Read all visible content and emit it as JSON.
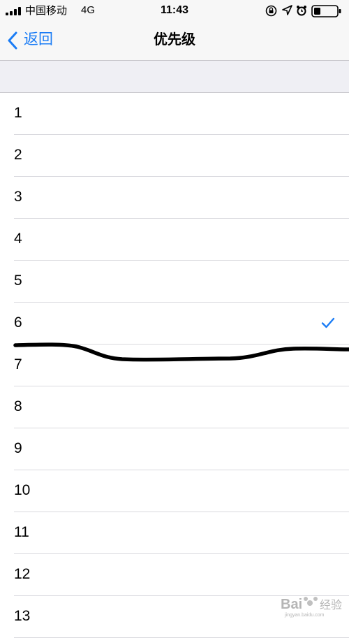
{
  "status_bar": {
    "carrier": "中国移动",
    "network": "4G",
    "time": "11:43"
  },
  "nav": {
    "back_label": "返回",
    "title": "优先级"
  },
  "accent_color": "#1a7cf5",
  "priority_list": {
    "selected": "6",
    "items": [
      {
        "label": "1"
      },
      {
        "label": "2"
      },
      {
        "label": "3"
      },
      {
        "label": "4"
      },
      {
        "label": "5"
      },
      {
        "label": "6"
      },
      {
        "label": "7"
      },
      {
        "label": "8"
      },
      {
        "label": "9"
      },
      {
        "label": "10"
      },
      {
        "label": "11"
      },
      {
        "label": "12"
      },
      {
        "label": "13"
      }
    ]
  },
  "icons": [
    "signal-icon",
    "rotation-lock-icon",
    "location-arrow-icon",
    "alarm-icon",
    "battery-icon",
    "back-chevron-icon",
    "checkmark-icon"
  ]
}
